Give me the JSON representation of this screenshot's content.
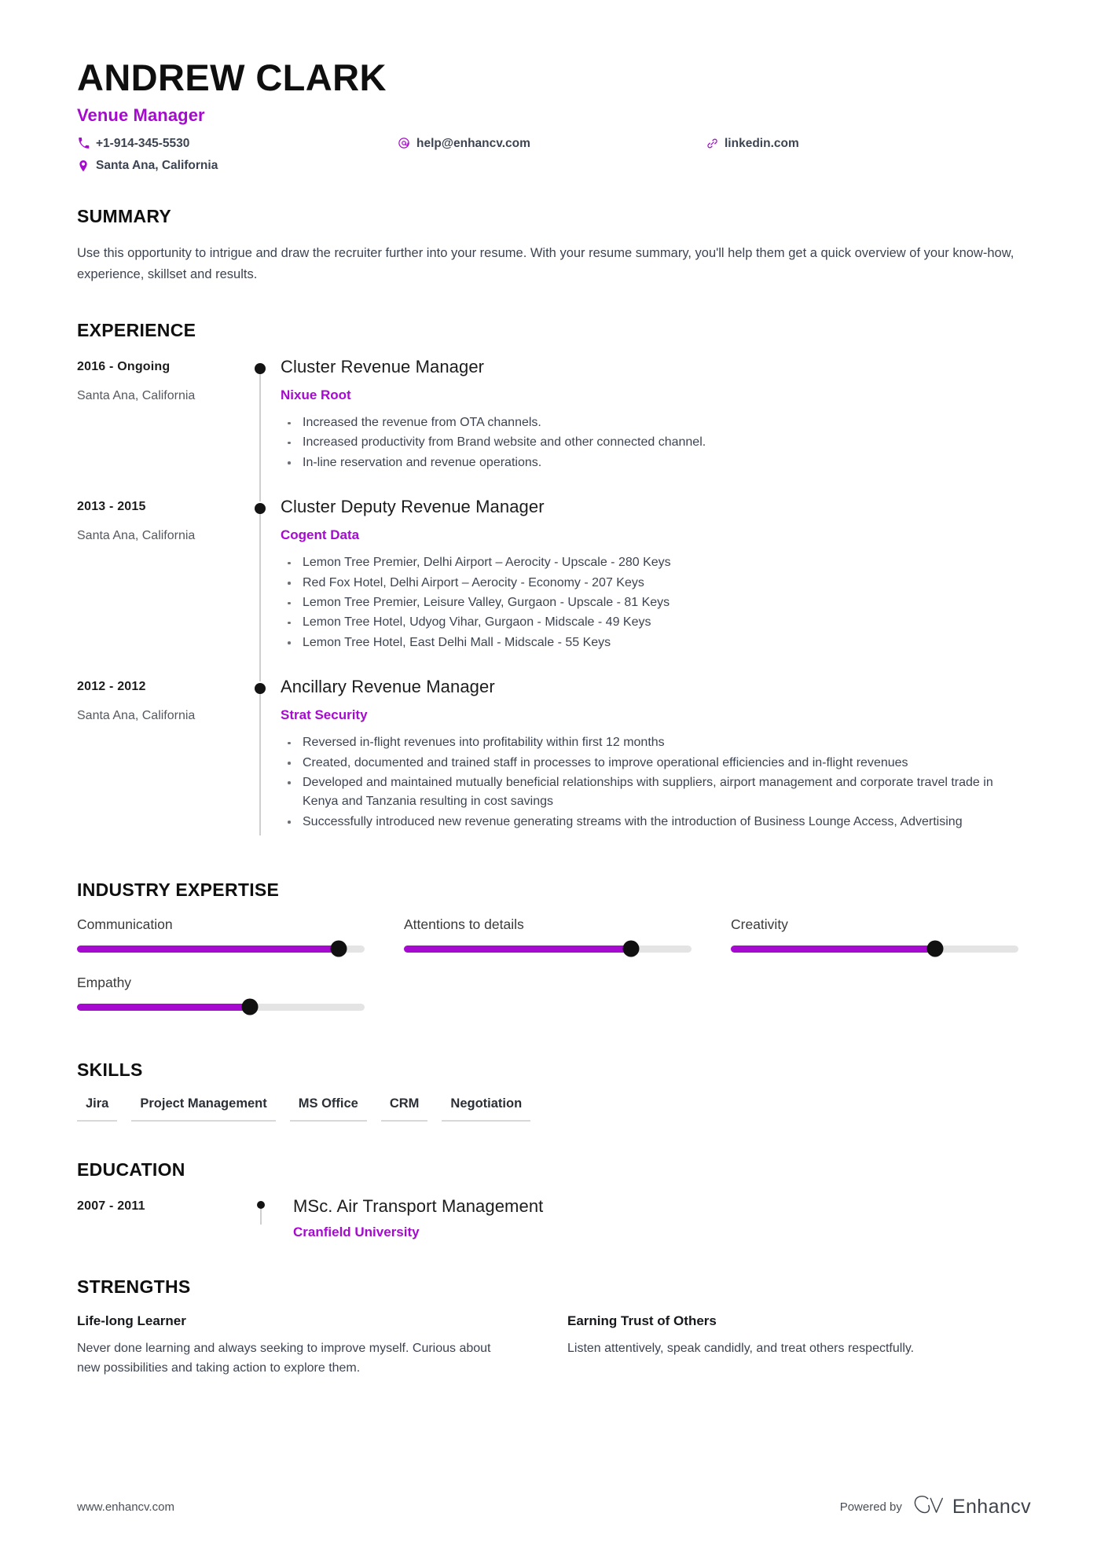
{
  "header": {
    "full_name": "ANDREW CLARK",
    "job_title": "Venue Manager",
    "contacts": [
      {
        "icon": "phone-icon",
        "value": "+1-914-345-5530"
      },
      {
        "icon": "email-icon",
        "value": "help@enhancv.com"
      },
      {
        "icon": "link-icon",
        "value": "linkedin.com"
      },
      {
        "icon": "location-pin-icon",
        "value": "Santa Ana, California"
      }
    ]
  },
  "summary": {
    "title": "SUMMARY",
    "text": "Use this opportunity to intrigue and draw the recruiter further into your resume. With your resume summary, you'll help them get a quick overview of your know-how, experience, skillset and results."
  },
  "experience": {
    "title": "EXPERIENCE",
    "entries": [
      {
        "date": "2016 - Ongoing",
        "location": "Santa Ana, California",
        "role": "Cluster Revenue Manager",
        "company": "Nixue Root",
        "bullets": [
          "Increased the revenue from OTA channels.",
          "Increased productivity from Brand website and other connected channel.",
          "In-line reservation and revenue operations."
        ]
      },
      {
        "date": "2013 - 2015",
        "location": "Santa Ana, California",
        "role": "Cluster Deputy Revenue Manager",
        "company": "Cogent Data",
        "bullets": [
          "Lemon Tree Premier, Delhi Airport – Aerocity - Upscale - 280 Keys",
          "Red Fox Hotel, Delhi Airport – Aerocity - Economy - 207 Keys",
          "Lemon Tree Premier, Leisure Valley, Gurgaon - Upscale - 81 Keys",
          "Lemon Tree Hotel, Udyog Vihar, Gurgaon - Midscale - 49 Keys",
          "Lemon Tree Hotel, East Delhi Mall - Midscale - 55 Keys"
        ]
      },
      {
        "date": "2012 - 2012",
        "location": "Santa Ana, California",
        "role": "Ancillary Revenue Manager",
        "company": "Strat Security",
        "bullets": [
          "Reversed in-flight revenues into profitability within first 12 months",
          "Created, documented and trained staff in processes to improve operational efficiencies and in-flight revenues",
          "Developed and maintained mutually beneficial relationships with suppliers, airport management and corporate travel trade in Kenya and Tanzania resulting in cost savings",
          "Successfully introduced new revenue generating streams with the introduction of Business Lounge Access, Advertising"
        ]
      }
    ]
  },
  "industry_expertise": {
    "title": "INDUSTRY EXPERTISE",
    "accent_color": "#a609cf",
    "track_color": "#e4e4e4",
    "knob_color": "#111111",
    "items": [
      {
        "label": "Communication",
        "value": 91
      },
      {
        "label": "Attentions to details",
        "value": 79
      },
      {
        "label": "Creativity",
        "value": 71
      },
      {
        "label": "Empathy",
        "value": 60
      }
    ]
  },
  "skills": {
    "title": "SKILLS",
    "items": [
      "Jira",
      "Project Management",
      "MS Office",
      "CRM",
      "Negotiation"
    ]
  },
  "education": {
    "title": "EDUCATION",
    "entries": [
      {
        "date": "2007 - 2011",
        "degree": "MSc. Air Transport Management",
        "school": "Cranfield University"
      }
    ]
  },
  "strengths": {
    "title": "STRENGTHS",
    "items": [
      {
        "name": "Life-long Learner",
        "description": "Never done learning and always seeking to improve myself. Curious about new possibilities and taking action to explore them."
      },
      {
        "name": "Earning Trust of Others",
        "description": "Listen attentively, speak candidly, and treat others respectfully."
      }
    ]
  },
  "footer": {
    "url": "www.enhancv.com",
    "powered_by": "Powered by",
    "brand_name": "Enhancv"
  }
}
